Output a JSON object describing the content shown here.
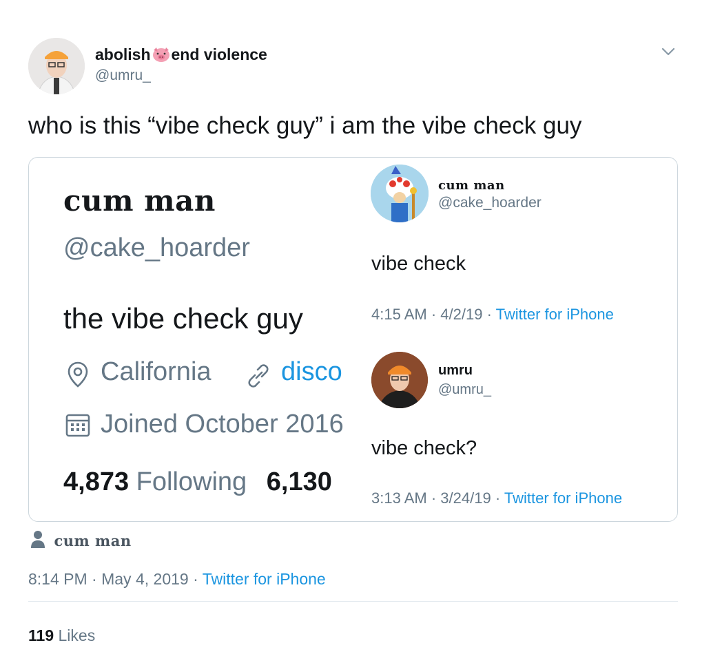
{
  "tweet": {
    "author_name_left": "abolish",
    "author_name_right": "end violence",
    "author_handle": "@umru_",
    "text": "who is this “vibe check guy” i am the vibe check guy",
    "time": "8:14 PM",
    "date": "May 4, 2019",
    "source": "Twitter for iPhone",
    "likes_count": "119",
    "likes_label": "Likes",
    "tagged_user": "cum man",
    "separator": "·"
  },
  "profile": {
    "display_name": "cum man",
    "handle": "@cake_hoarder",
    "bio": "the vibe check guy",
    "location": "California",
    "link_text": "disco",
    "joined": "Joined October 2016",
    "following_count": "4,873",
    "following_label": "Following",
    "followers_count": "6,130"
  },
  "embedded_tweets": [
    {
      "name": "cum man",
      "handle": "@cake_hoarder",
      "text": "vibe check",
      "time": "4:15 AM",
      "date": "4/2/19",
      "source": "Twitter for iPhone"
    },
    {
      "name": "umru",
      "handle": "@umru_",
      "text": "vibe check?",
      "time": "3:13 AM",
      "date": "3/24/19",
      "source": "Twitter for iPhone"
    }
  ],
  "colors": {
    "link": "#1b95e0",
    "muted": "#657786",
    "border": "#ccd6dd",
    "pig_emoji": "#f4a0b4"
  },
  "icons": [
    "pig-emoji-icon",
    "chevron-down-icon",
    "location-pin-icon",
    "link-icon",
    "calendar-icon",
    "person-icon"
  ]
}
